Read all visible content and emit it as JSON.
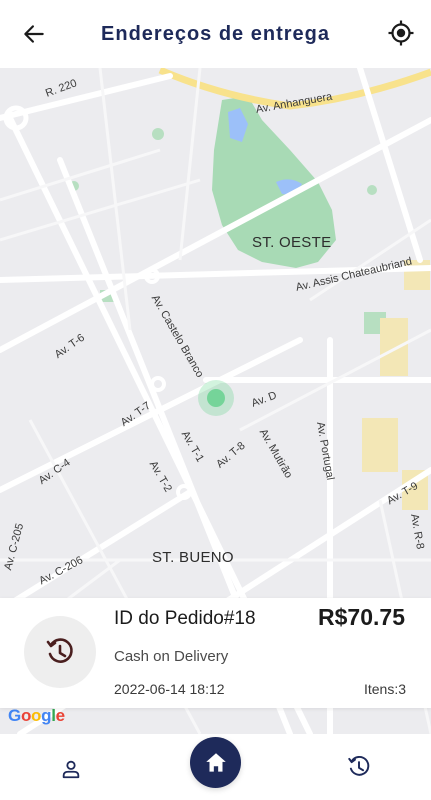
{
  "header": {
    "title": "Endereços de entrega",
    "back_icon": "arrow-left-icon",
    "locate_icon": "crosshair-location-icon"
  },
  "map": {
    "labels": {
      "r220": "R. 220",
      "anhanguera": "Av. Anhanguera",
      "st_oeste": "ST. OESTE",
      "assis": "Av. Assis Chateaubriand",
      "castelo_branco": "Av. Castelo Branco",
      "t6": "Av. T-6",
      "t7": "Av. T-7",
      "d": "Av. D",
      "portugal": "Av. Portugal",
      "mutirao": "Av. Mutirão",
      "t1": "Av. T-1",
      "t8": "Av. T-8",
      "t2": "Av. T-2",
      "c4": "Av. C-4",
      "t9": "Av. T-9",
      "c205": "Av. C-205",
      "c206": "Av. C-206",
      "st_bueno": "ST. BUENO",
      "r8": "Av. R-8"
    },
    "google": [
      "G",
      "o",
      "o",
      "g",
      "l",
      "e"
    ],
    "zoom_in": "+"
  },
  "order": {
    "id_label": "ID do Pedido#18",
    "amount": "R$70.75",
    "payment": "Cash on Delivery",
    "date": "2022-06-14 18:12",
    "items": "Itens:3",
    "icon": "history-refresh-icon"
  },
  "nav": {
    "profile_icon": "user-icon",
    "home_icon": "home-icon",
    "history_icon": "history-icon"
  },
  "colors": {
    "primary": "#1e2a5a",
    "map_bg": "#ececef",
    "park": "#a8dab5",
    "water": "#9cc0f9",
    "highway": "#f8e28c",
    "marker": "#34c76b"
  }
}
